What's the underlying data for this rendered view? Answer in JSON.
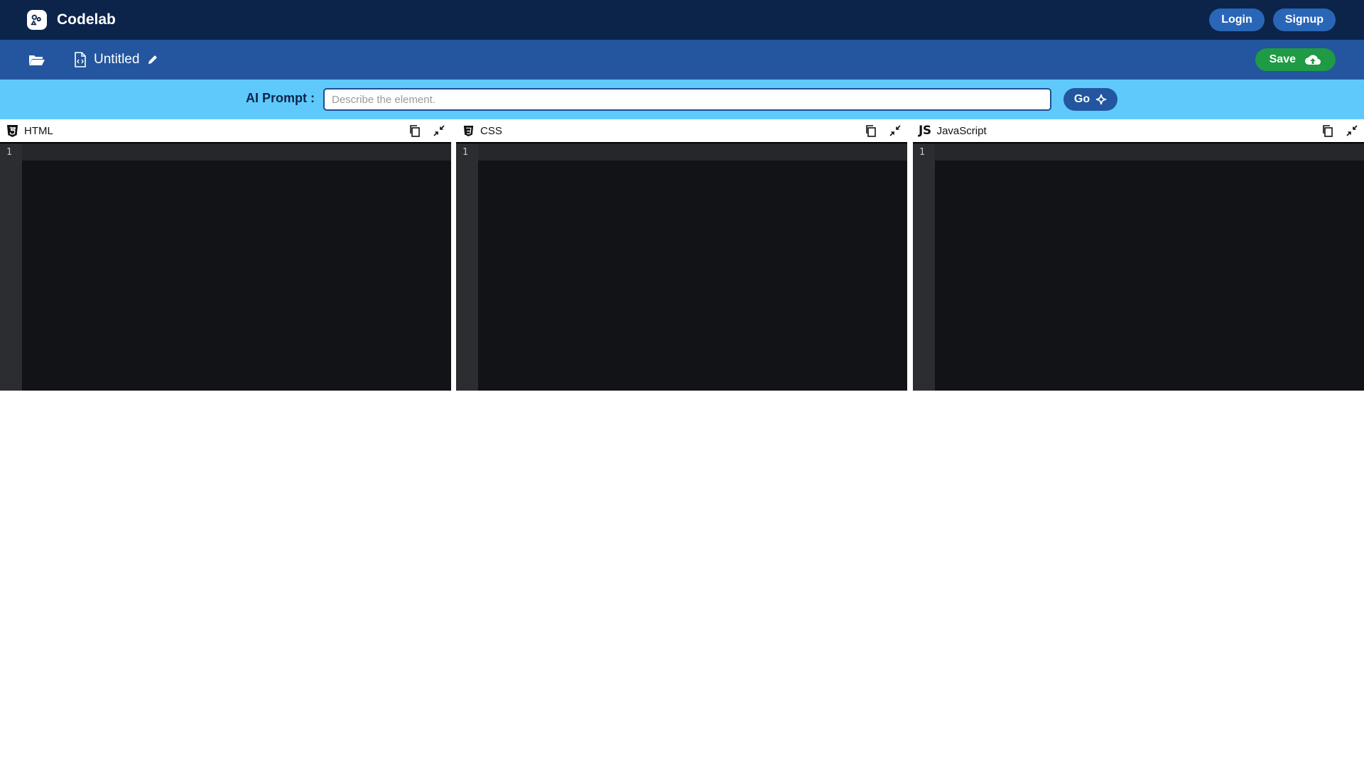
{
  "app": {
    "name": "Codelab"
  },
  "auth": {
    "login_label": "Login",
    "signup_label": "Signup"
  },
  "file": {
    "title": "Untitled",
    "save_label": "Save"
  },
  "ai_prompt": {
    "label": "AI Prompt :",
    "placeholder": "Describe the element.",
    "value": "",
    "go_label": "Go"
  },
  "editors": [
    {
      "lang": "HTML",
      "icon": "html5-icon",
      "lines": [
        "1"
      ]
    },
    {
      "lang": "CSS",
      "icon": "css3-icon",
      "lines": [
        "1"
      ]
    },
    {
      "lang": "JavaScript",
      "icon": "js-icon",
      "icon_text": "JS",
      "lines": [
        "1"
      ]
    }
  ],
  "colors": {
    "topbar": "#0c244a",
    "filebar": "#23569f",
    "aibar": "#5fc9fb",
    "button": "#2a66b8",
    "save": "#1f9a45",
    "editor_bg": "#111317",
    "gutter_bg": "#2b2d31"
  }
}
